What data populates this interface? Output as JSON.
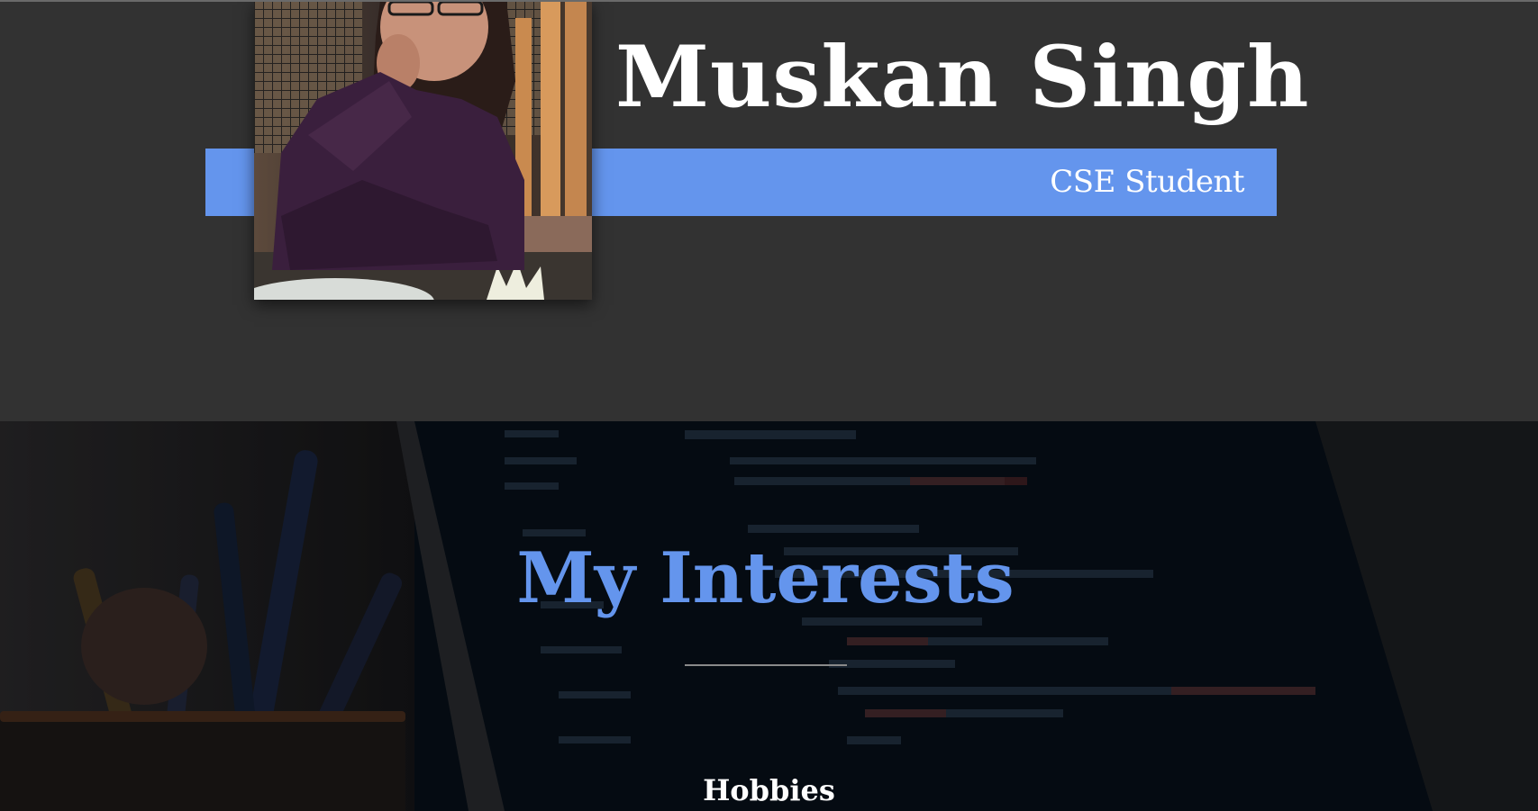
{
  "header": {
    "name": "Muskan Singh",
    "role": "CSE Student",
    "photo_alt": "profile-photo"
  },
  "interests": {
    "title": "My Interests",
    "subheading": "Hobbies"
  },
  "colors": {
    "accent": "#6495ed",
    "header_bg": "#323232",
    "text": "#ffffff"
  }
}
